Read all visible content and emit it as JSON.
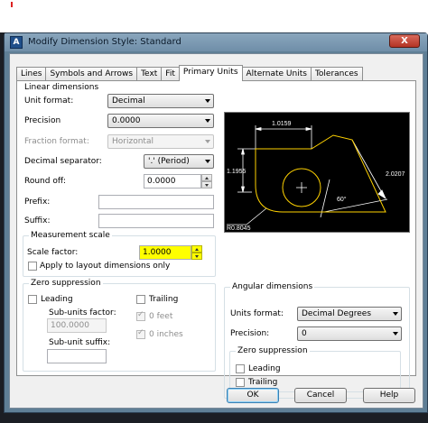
{
  "window": {
    "title": "Modify Dimension Style: Standard",
    "close_label": "X"
  },
  "tabs": [
    {
      "label": "Lines",
      "active": false
    },
    {
      "label": "Symbols and Arrows",
      "active": false
    },
    {
      "label": "Text",
      "active": false
    },
    {
      "label": "Fit",
      "active": false
    },
    {
      "label": "Primary Units",
      "active": true
    },
    {
      "label": "Alternate Units",
      "active": false
    },
    {
      "label": "Tolerances",
      "active": false
    }
  ],
  "linear": {
    "legend": "Linear dimensions",
    "unit_format_label": "Unit format:",
    "unit_format_value": "Decimal",
    "precision_label": "Precision",
    "precision_value": "0.0000",
    "fraction_format_label": "Fraction format:",
    "fraction_format_value": "Horizontal",
    "decimal_separator_label": "Decimal separator:",
    "decimal_separator_value": "'.' (Period)",
    "round_off_label": "Round off:",
    "round_off_value": "0.0000",
    "prefix_label": "Prefix:",
    "prefix_value": "",
    "suffix_label": "Suffix:",
    "suffix_value": ""
  },
  "measurement_scale": {
    "legend": "Measurement scale",
    "scale_factor_label": "Scale factor:",
    "scale_factor_value": "1.0000",
    "apply_layout_label": "Apply to layout dimensions only"
  },
  "zero_suppression_linear": {
    "legend": "Zero suppression",
    "leading_label": "Leading",
    "trailing_label": "Trailing",
    "subunits_factor_label": "Sub-units factor:",
    "subunits_factor_value": "100.0000",
    "subunit_suffix_label": "Sub-unit suffix:",
    "subunit_suffix_value": "",
    "zero_feet_label": "0 feet",
    "zero_inches_label": "0 inches"
  },
  "preview": {
    "dim_top": "1.0159",
    "dim_left": "1.1955",
    "dim_right": "2.0207",
    "angle": "60°",
    "radius": "R0.8045",
    "colors": {
      "background": "#000000",
      "geometry": "#ffd200",
      "dimension": "#ffffff"
    }
  },
  "angular": {
    "legend": "Angular dimensions",
    "units_format_label": "Units format:",
    "units_format_value": "Decimal Degrees",
    "precision_label": "Precision:",
    "precision_value": "0",
    "zs_legend": "Zero suppression",
    "leading_label": "Leading",
    "trailing_label": "Trailing"
  },
  "buttons": {
    "ok": "OK",
    "cancel": "Cancel",
    "help": "Help"
  }
}
